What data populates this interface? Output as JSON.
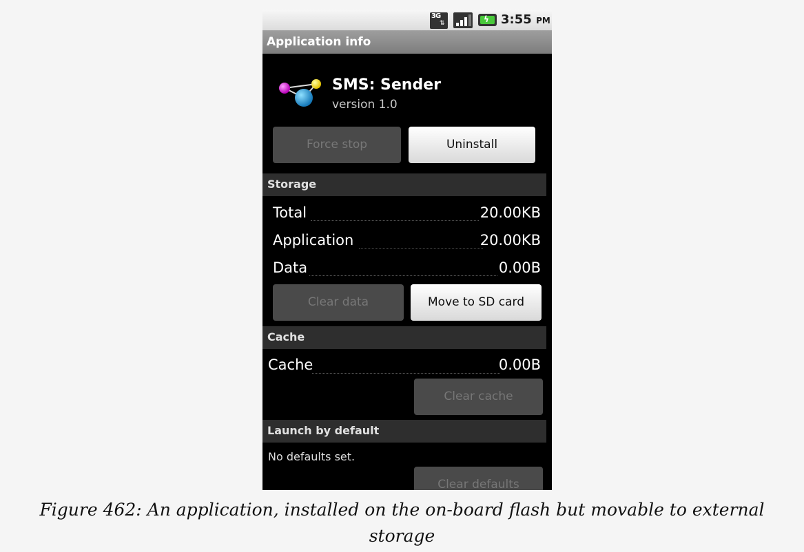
{
  "status_bar": {
    "network_label": "3G",
    "time": "3:55",
    "ampm": "PM",
    "battery_color": "#49c93b"
  },
  "title_bar": {
    "title": "Application info"
  },
  "app": {
    "name": "SMS: Sender",
    "version": "version 1.0",
    "icon": "molecule-icon"
  },
  "actions": {
    "force_stop": "Force stop",
    "uninstall": "Uninstall"
  },
  "storage": {
    "header": "Storage",
    "rows": [
      {
        "label": "Total",
        "value": "20.00KB"
      },
      {
        "label": "Application",
        "value": "20.00KB"
      },
      {
        "label": "Data",
        "value": "0.00B"
      }
    ],
    "clear_data": "Clear data",
    "move_to_sd": "Move to SD card"
  },
  "cache": {
    "header": "Cache",
    "label": "Cache",
    "value": "0.00B",
    "clear_cache": "Clear cache"
  },
  "launch_default": {
    "header": "Launch by default",
    "text": "No defaults set.",
    "clear_defaults": "Clear defaults"
  },
  "caption": {
    "line1": "Figure 462: An application, installed on the on-board flash but movable to external",
    "line2": "storage"
  }
}
